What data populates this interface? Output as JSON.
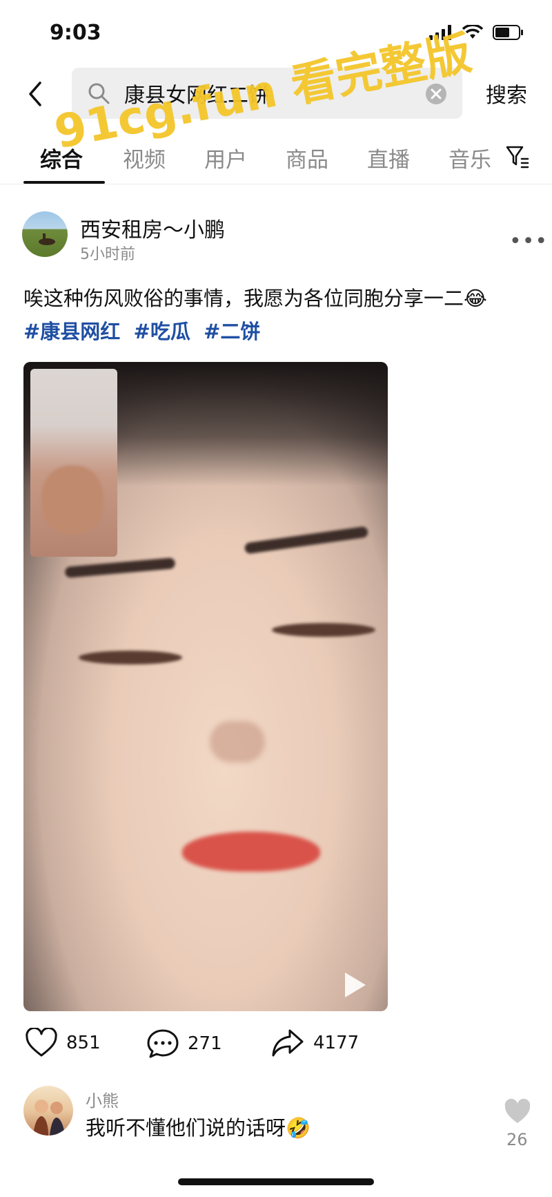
{
  "status_bar": {
    "time": "9:03"
  },
  "search": {
    "query": "康县女网红二饼",
    "button_label": "搜索"
  },
  "tabs": [
    {
      "label": "综合",
      "active": true
    },
    {
      "label": "视频",
      "active": false
    },
    {
      "label": "用户",
      "active": false
    },
    {
      "label": "商品",
      "active": false
    },
    {
      "label": "直播",
      "active": false
    },
    {
      "label": "音乐",
      "active": false
    }
  ],
  "post": {
    "author": "西安租房～小鹏",
    "time_ago": "5小时前",
    "text": "唉这种伤风败俗的事情，我愿为各位同胞分享一二😂",
    "hashtags": [
      "#康县网红",
      "#吃瓜",
      "#二饼"
    ],
    "likes": "851",
    "comments": "271",
    "shares": "4177"
  },
  "comment": {
    "user": "小熊",
    "text": "我听不懂他们说的话呀🤣",
    "likes": "26"
  },
  "watermark": "91cg.fun 看完整版",
  "colors": {
    "hashtag": "#1f4fa3",
    "watermark": "#f4c62a",
    "muted": "#8a8a8a"
  }
}
